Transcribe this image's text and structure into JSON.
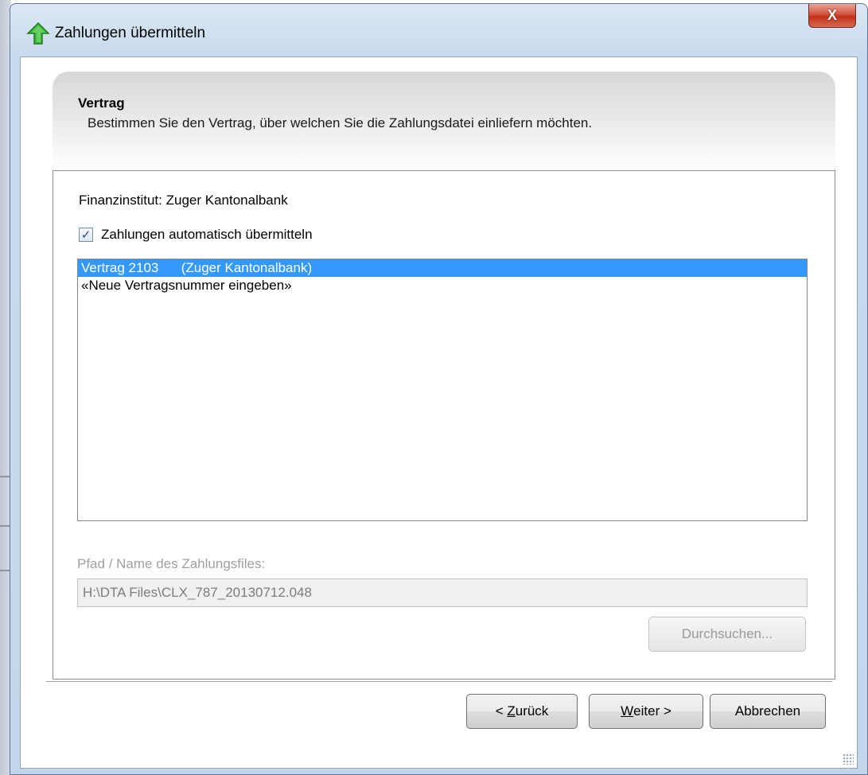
{
  "window": {
    "title": "Zahlungen übermitteln",
    "close_glyph": "X"
  },
  "header": {
    "title": "Vertrag",
    "subtitle": "Bestimmen Sie den Vertrag, über welchen Sie die Zahlungsdatei einliefern möchten."
  },
  "form": {
    "finanzinstitut_label": "Finanzinstitut: Zuger Kantonalbank",
    "auto_checkbox": {
      "label": "Zahlungen automatisch übermitteln",
      "checked": true
    },
    "contracts": [
      {
        "label": "Vertrag 2103      (Zuger Kantonalbank)",
        "selected": true
      },
      {
        "label": "«Neue Vertragsnummer eingeben»",
        "selected": false
      }
    ],
    "path_label": "Pfad / Name des Zahlungsfiles:",
    "path_value": "H:\\DTA Files\\CLX_787_20130712.048",
    "browse_label": "Durchsuchen..."
  },
  "buttons": {
    "back_prefix": "< ",
    "back_accel": "Z",
    "back_rest": "urück",
    "next_accel": "W",
    "next_rest": "eiter >",
    "cancel": "Abbrechen"
  },
  "colors": {
    "selection": "#3399ff",
    "close_button": "#c2311b",
    "app_icon": "#3cb83c"
  },
  "icons": {
    "app": "green-up-arrow-icon",
    "close": "close-icon",
    "check": "checkmark-icon",
    "grip": "resize-grip-icon"
  }
}
